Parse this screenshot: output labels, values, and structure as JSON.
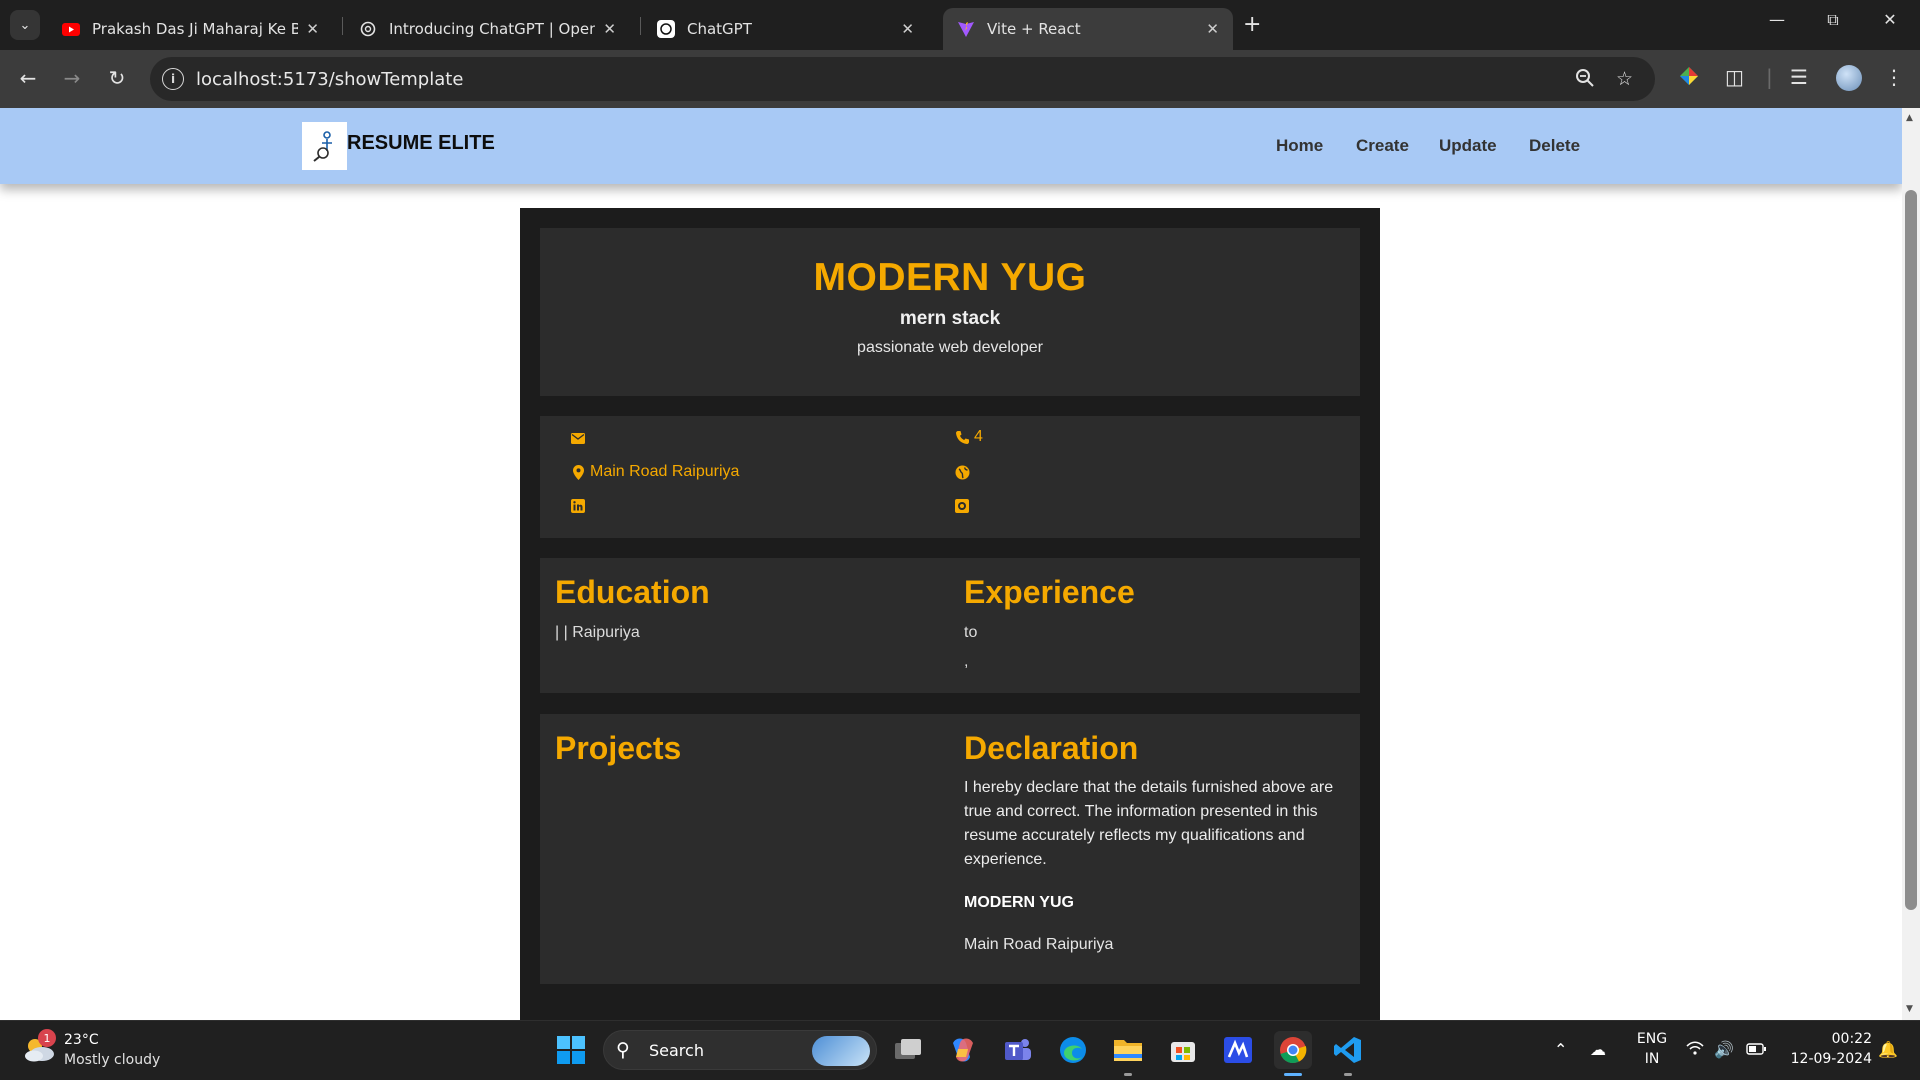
{
  "browser": {
    "tabs": [
      {
        "title": "Prakash Das Ji Maharaj Ke Bhajan",
        "icon": "youtube-icon"
      },
      {
        "title": "Introducing ChatGPT | OpenAI",
        "icon": "openai-icon"
      },
      {
        "title": "ChatGPT",
        "icon": "chatgpt-icon"
      },
      {
        "title": "Vite + React",
        "icon": "vite-icon"
      }
    ],
    "url": "localhost:5173/showTemplate"
  },
  "site": {
    "brand": "RESUME ELITE",
    "nav": [
      "Home",
      "Create",
      "Update",
      "Delete"
    ]
  },
  "resume": {
    "name": "MODERN YUG",
    "role": "mern stack",
    "tagline": "passionate web developer",
    "contact": {
      "email": "",
      "phone": "4",
      "address": "Main Road Raipuriya",
      "website": "",
      "linkedin": "",
      "github": ""
    },
    "education": {
      "title": "Education",
      "text": "| | Raipuriya"
    },
    "experience": {
      "title": "Experience",
      "text": "to",
      "extra": ","
    },
    "projects": {
      "title": "Projects"
    },
    "declaration": {
      "title": "Declaration",
      "text": "I hereby declare that the details furnished above are true and correct. The information presented in this resume accurately reflects my qualifications and experience.",
      "name": "MODERN YUG",
      "address": "Main Road Raipuriya"
    }
  },
  "taskbar": {
    "weather": {
      "temp": "23°C",
      "desc": "Mostly cloudy",
      "badge": "1"
    },
    "search_label": "Search",
    "lang": "ENG",
    "region": "IN",
    "time": "00:22",
    "date": "12-09-2024"
  },
  "colors": {
    "accent": "#f5a900",
    "nav_bg": "#a8c9f5",
    "resume_bg": "#1c1c1c",
    "card_bg": "#2c2c2c"
  }
}
